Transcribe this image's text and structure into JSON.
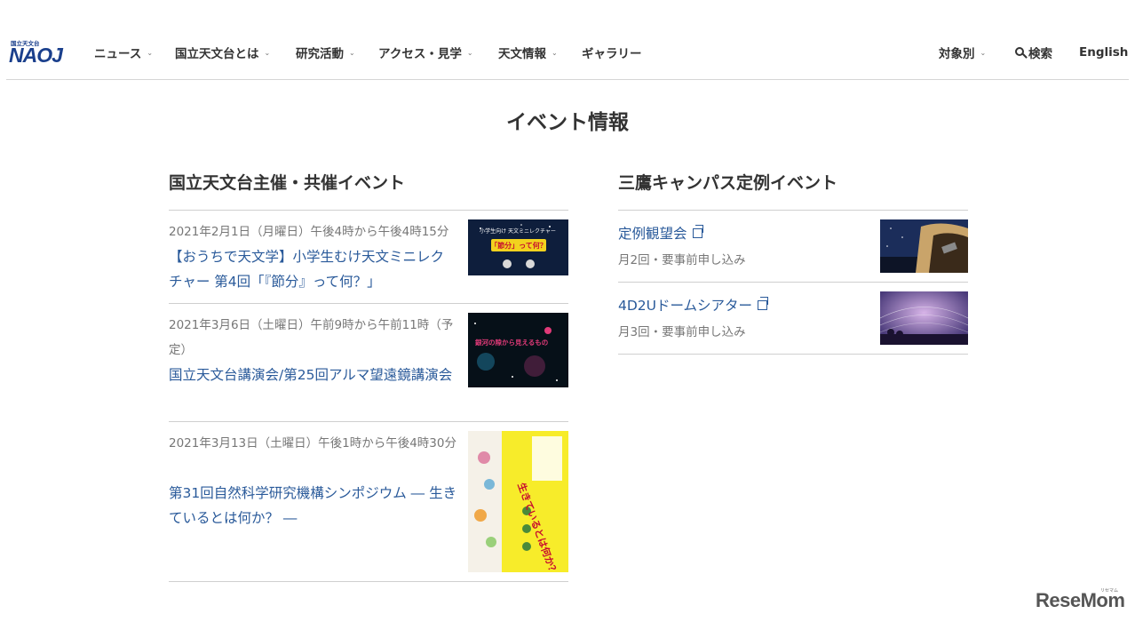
{
  "header": {
    "logo": {
      "small_text": "国立天文台",
      "text": "NAOJ"
    },
    "nav": [
      {
        "label": "ニュース",
        "has_dropdown": true
      },
      {
        "label": "国立天文台とは",
        "has_dropdown": true
      },
      {
        "label": "研究活動",
        "has_dropdown": true
      },
      {
        "label": "アクセス・見学",
        "has_dropdown": true
      },
      {
        "label": "天文情報",
        "has_dropdown": true
      },
      {
        "label": "ギャラリー",
        "has_dropdown": false
      }
    ],
    "right": {
      "audience_label": "対象別",
      "search_label": "検索",
      "language_label": "English"
    }
  },
  "page_title": "イベント情報",
  "hosted_events": {
    "title": "国立天文台主催・共催イベント",
    "items": [
      {
        "date": "2021年2月1日（月曜日）午後4時から午後4時15分",
        "title": "【おうちで天文学】小学生むけ天文ミニレクチャー 第4回「『節分』って何？」",
        "thumbnail": {
          "kind": "poster",
          "texts": [
            "小学生向け 天文ミニレクチャー",
            "「節分」って何？"
          ],
          "colors": {
            "bg": "#0e1e3c",
            "accent": "#f2d21e"
          }
        }
      },
      {
        "date": "2021年3月6日（土曜日）午前9時から午前11時（予定）",
        "title": "国立天文台講演会/第25回アルマ望遠鏡講演会",
        "thumbnail": {
          "kind": "poster",
          "texts": [
            "銀河の隙から見えるもの"
          ],
          "colors": {
            "bg": "#061018",
            "accent": "#e03a78"
          }
        }
      },
      {
        "date": "2021年3月13日（土曜日）午後1時から午後4時30分",
        "title": "第31回自然科学研究機構シンポジウム ― 生きているとは何か？ ―",
        "thumbnail": {
          "kind": "poster",
          "texts": [
            "生きているとは何か？"
          ],
          "colors": {
            "bg": "#f5f1e8",
            "accent": "#f7ec2a"
          }
        }
      }
    ]
  },
  "campus_events": {
    "title": "三鷹キャンパス定例イベント",
    "items": [
      {
        "title": "定例観望会",
        "external": true,
        "subtitle": "月2回・要事前申し込み",
        "thumbnail": {
          "kind": "telescope-photo",
          "colors": {
            "sky": "#1b2d5a",
            "dome": "#c9a46a"
          }
        }
      },
      {
        "title": "4D2Uドームシアター",
        "external": true,
        "subtitle": "月3回・要事前申し込み",
        "thumbnail": {
          "kind": "dome-theater-photo",
          "colors": {
            "sky": "#6a4a8c",
            "glow": "#d7b4e8"
          }
        }
      }
    ]
  },
  "watermark": {
    "text": "ReseMom",
    "kana": "リセマム"
  },
  "colors": {
    "link": "#2a5a9a",
    "brand_blue": "#1a3f8c",
    "ring_blue": "#1e8fd8",
    "muted": "#777777"
  }
}
